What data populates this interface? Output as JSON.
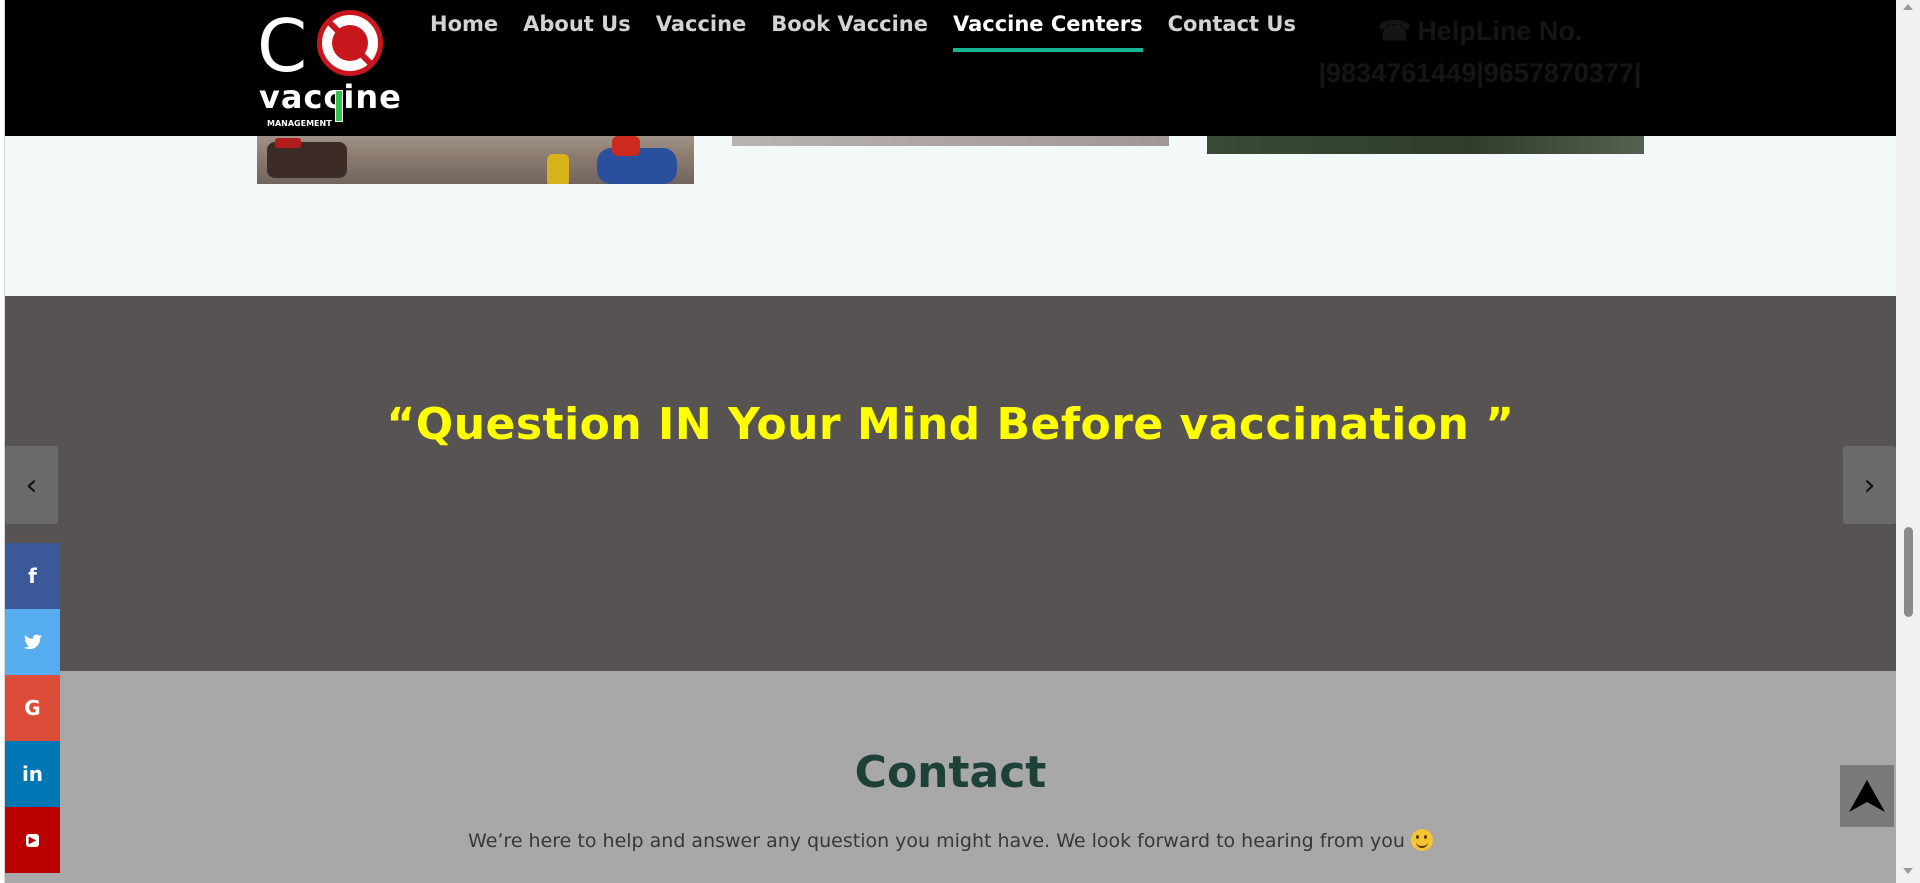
{
  "header": {
    "logo": {
      "letter": "C",
      "word": "vaccine",
      "subtitle": "MANAGEMENT"
    },
    "nav": [
      {
        "label": "Home",
        "active": false
      },
      {
        "label": "About Us",
        "active": false
      },
      {
        "label": "Vaccine",
        "active": false
      },
      {
        "label": "Book Vaccine",
        "active": false
      },
      {
        "label": "Vaccine Centers",
        "active": true
      },
      {
        "label": "Contact Us",
        "active": false
      }
    ],
    "helpline": {
      "icon": "phone-icon",
      "label": "HelpLine No.",
      "numbers": "|9834761449|9657870377|"
    }
  },
  "quote_section": {
    "quote": "“Question IN Your Mind Before vaccination ”",
    "prev_label": "‹",
    "next_label": "›"
  },
  "contact": {
    "title": "Contact",
    "text": "We’re here to help and answer any question you might have. We look forward to hearing from you"
  },
  "social": [
    {
      "label": "f",
      "icon": "facebook-icon"
    },
    {
      "label": "t",
      "icon": "twitter-icon"
    },
    {
      "label": "G",
      "icon": "google-icon"
    },
    {
      "label": "in",
      "icon": "linkedin-icon"
    },
    {
      "label": "You Tube",
      "icon": "youtube-icon"
    }
  ],
  "colors": {
    "header_bg": "#000000",
    "nav_active_underline": "#1ab394",
    "quote_bg": "#575352",
    "quote_text": "#ffff00",
    "contact_bg": "#a8a8a8",
    "contact_title": "#1d4038"
  }
}
